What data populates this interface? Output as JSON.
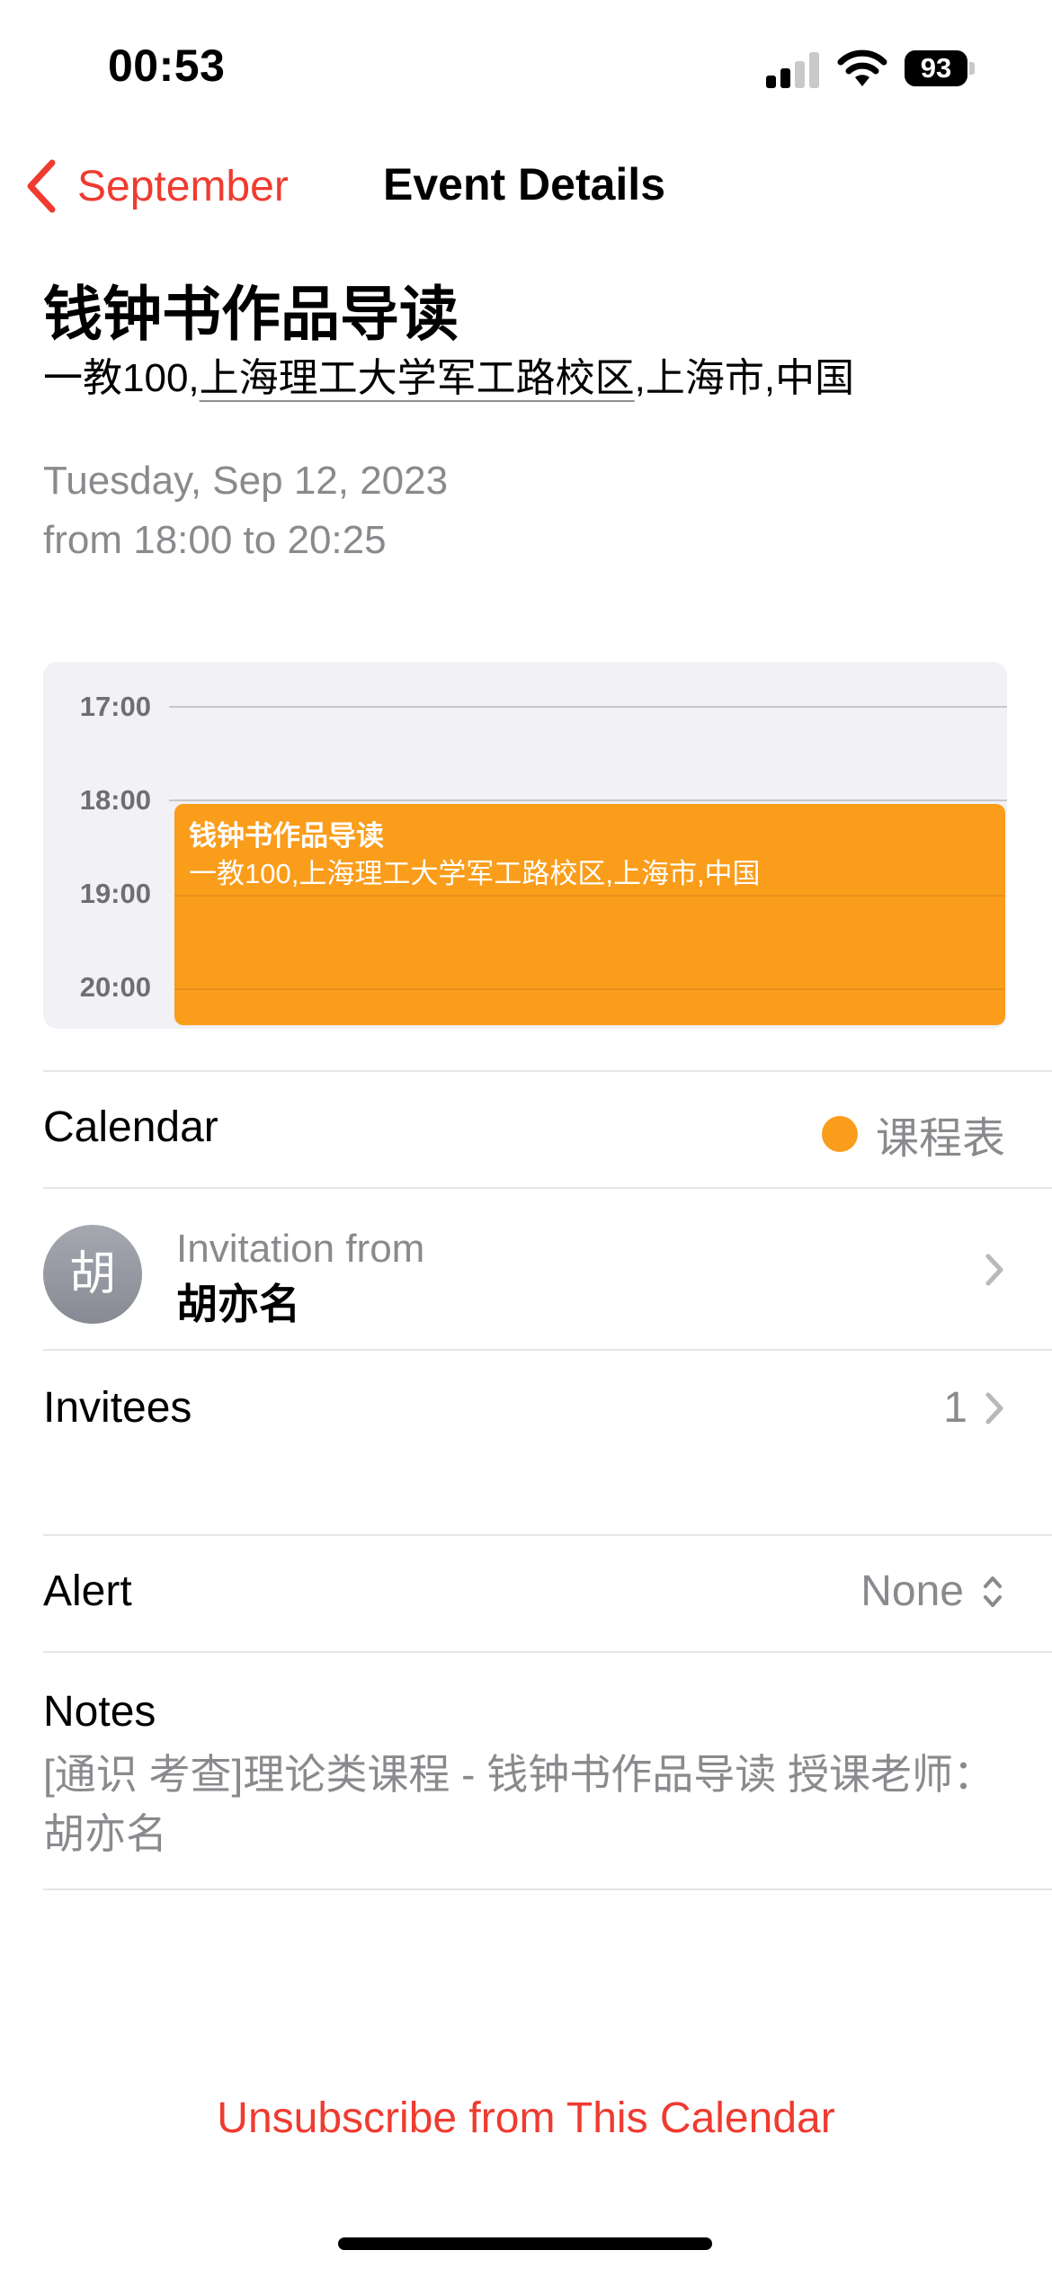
{
  "status_bar": {
    "time": "00:53",
    "battery": "93"
  },
  "nav": {
    "back_label": "September",
    "title": "Event Details"
  },
  "event": {
    "title": "钱钟书作品导读",
    "location_prefix": "一教100,",
    "location_link": "上海理工大学军工路校区",
    "location_suffix": ",上海市,中国",
    "date": "Tuesday, Sep 12, 2023",
    "time_range": "from 18:00 to 20:25"
  },
  "preview": {
    "hours": [
      "17:00",
      "18:00",
      "19:00",
      "20:00"
    ],
    "event_title": "钱钟书作品导读",
    "event_location": "一教100,上海理工大学军工路校区,上海市,中国"
  },
  "calendar_row": {
    "label": "Calendar",
    "value": "课程表",
    "color": "#fa9d1b"
  },
  "invitation": {
    "avatar_char": "胡",
    "label": "Invitation from",
    "name": "胡亦名"
  },
  "invitees_row": {
    "label": "Invitees",
    "count": "1"
  },
  "alert_row": {
    "label": "Alert",
    "value": "None"
  },
  "notes": {
    "label": "Notes",
    "text": "[通识 考查]理论类课程 - 钱钟书作品导读 授课老师：胡亦名"
  },
  "unsubscribe": {
    "label": "Unsubscribe from This Calendar"
  },
  "colors": {
    "accent": "#ef3b30",
    "event": "#fa9d1b"
  }
}
